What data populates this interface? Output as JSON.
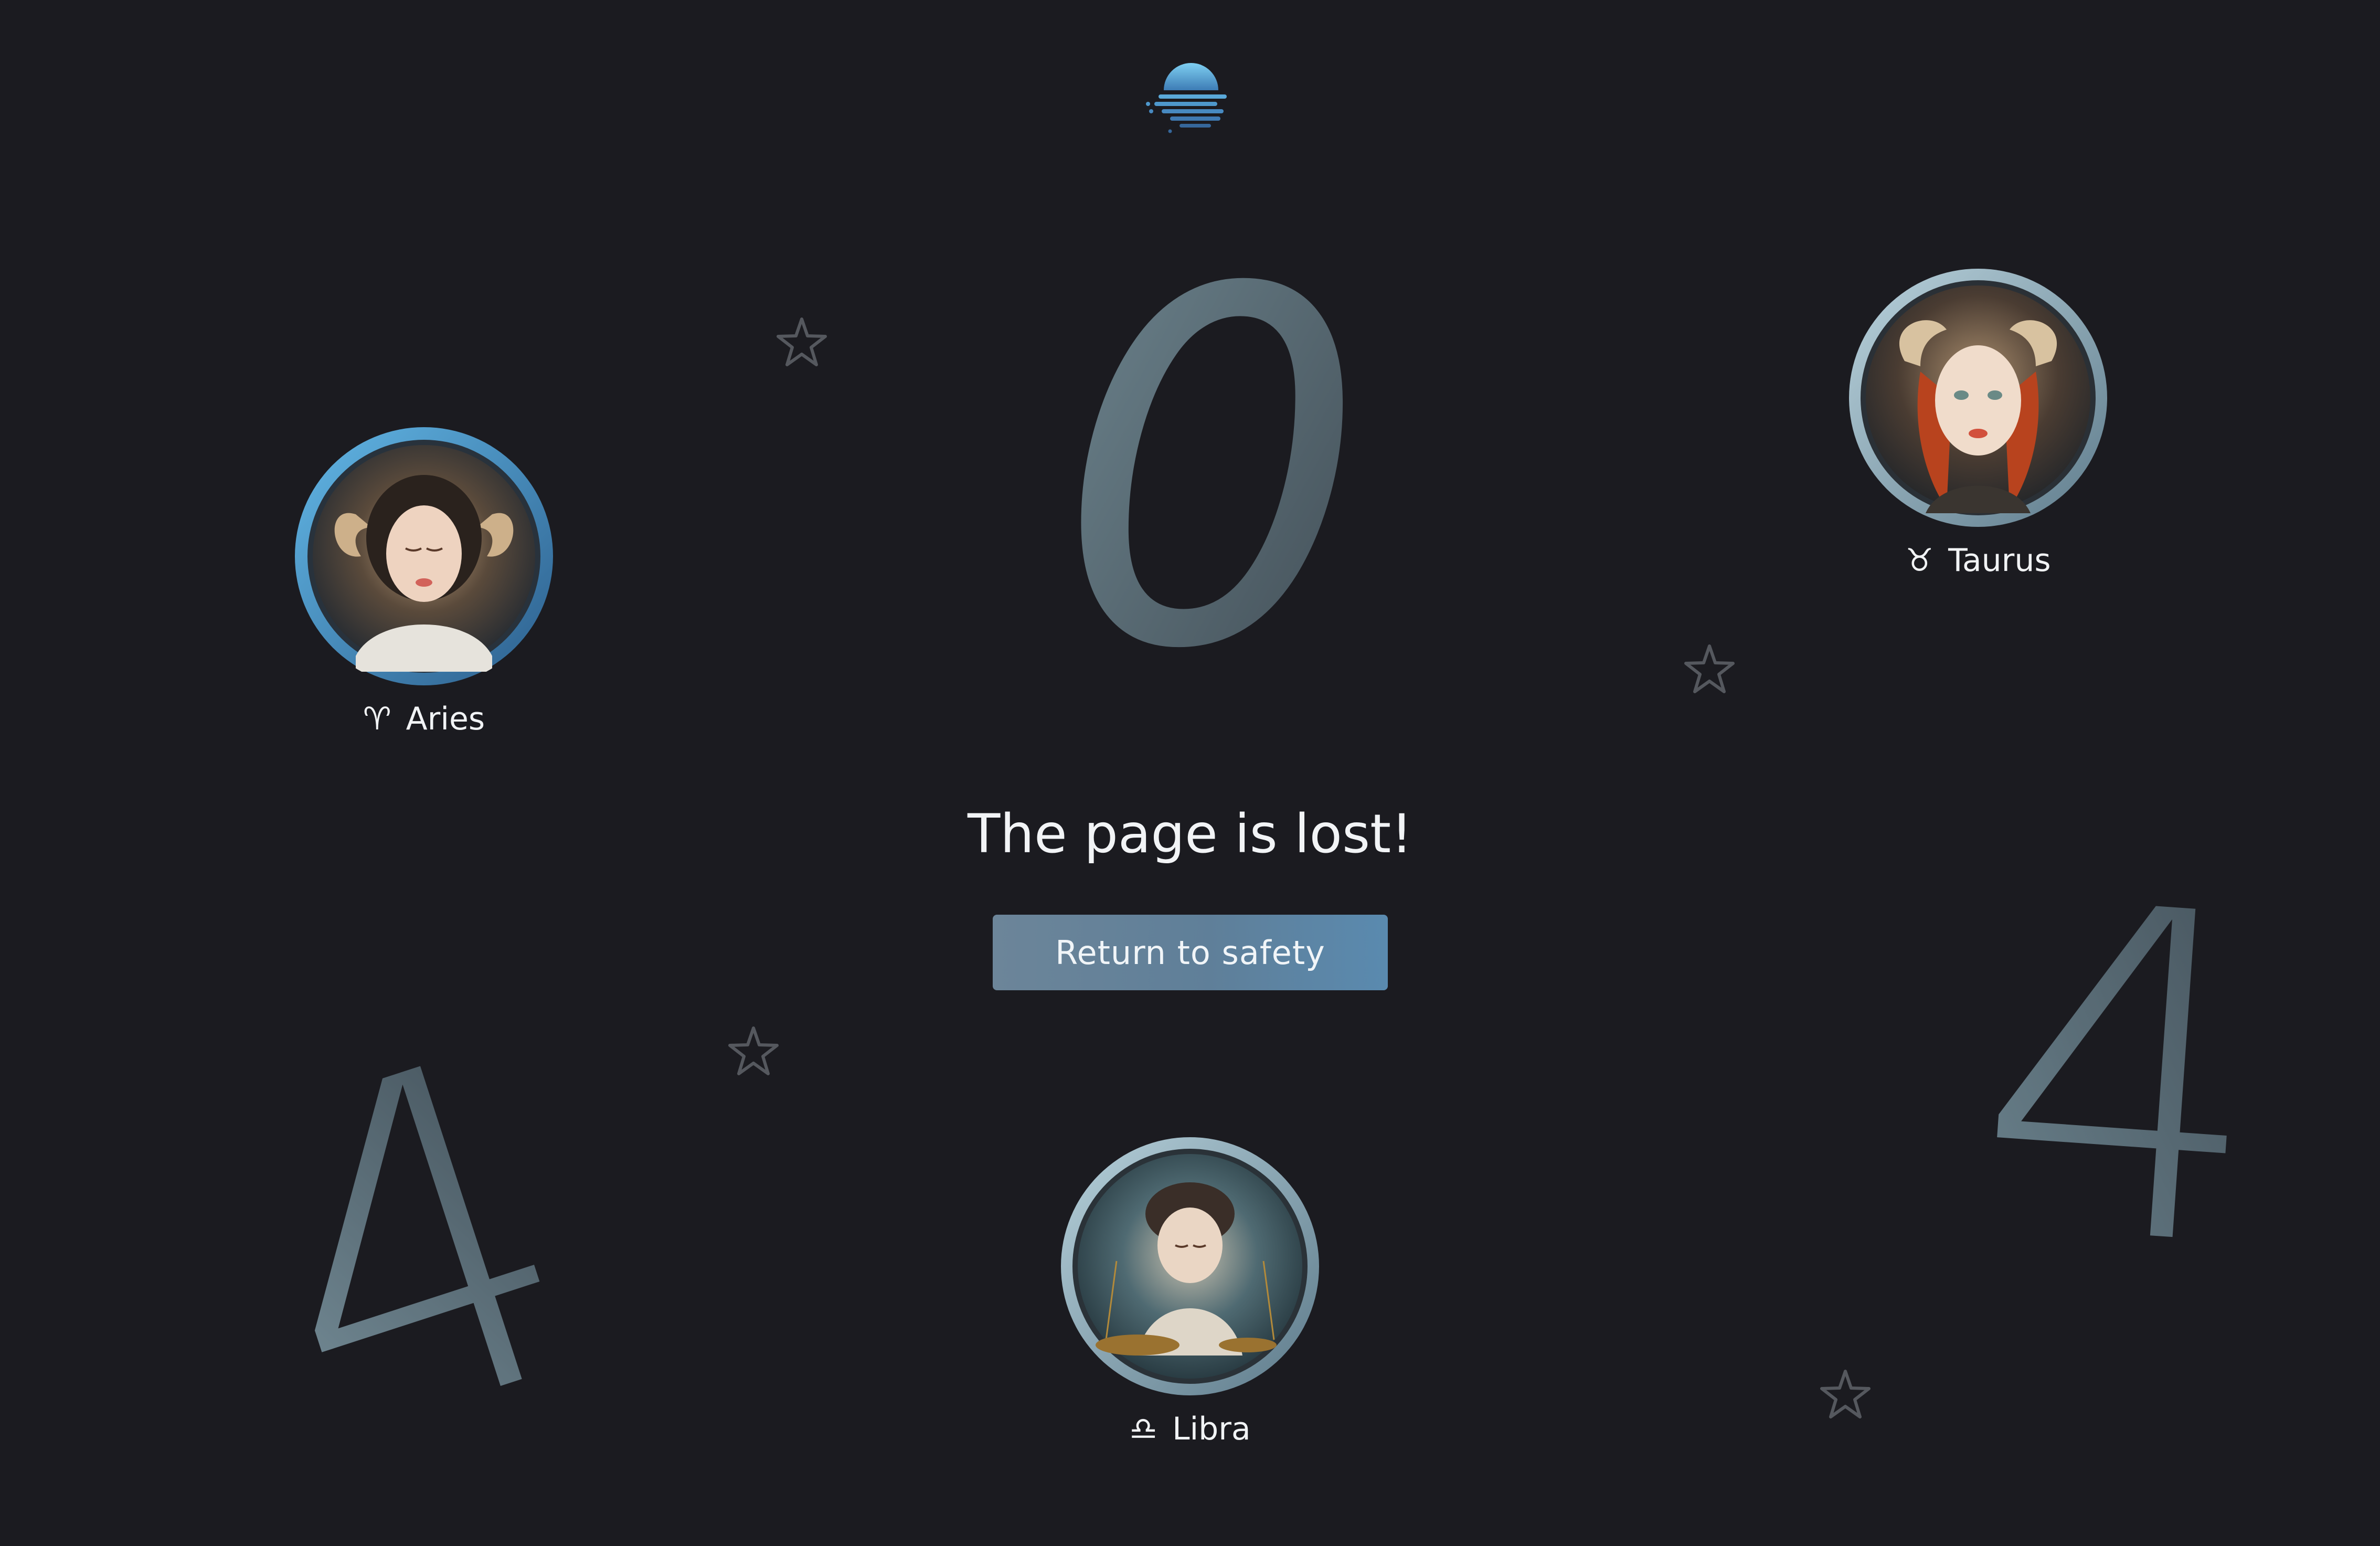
{
  "logo": {
    "icon": "moon-horizon-logo-icon",
    "color": "#5aa9d9"
  },
  "error_code": {
    "first": "4",
    "middle": "0",
    "last": "4"
  },
  "message": {
    "title": "The page is lost!"
  },
  "actions": {
    "return_label": "Return to safety"
  },
  "signs": [
    {
      "name": "Aries",
      "glyph": "♈︎",
      "icon": "aries-glyph-icon",
      "ring_color": "#4a8fc0"
    },
    {
      "name": "Taurus",
      "glyph": "♉︎",
      "icon": "taurus-glyph-icon",
      "ring_color": "#8aa6b4"
    },
    {
      "name": "Libra",
      "glyph": "♎︎",
      "icon": "libra-glyph-icon",
      "ring_color": "#8aa6b4"
    }
  ],
  "colors": {
    "background": "#1b1b20",
    "digit": "#5d6f78",
    "button": "#6683a0",
    "star_outline": "#5a5d63"
  }
}
